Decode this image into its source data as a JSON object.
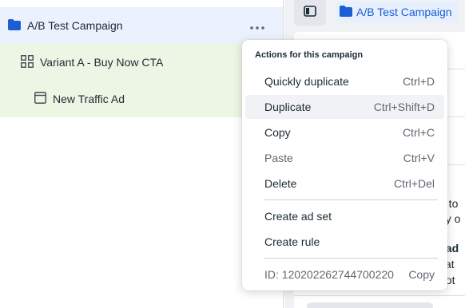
{
  "tree": {
    "campaign": {
      "label": "A/B Test Campaign",
      "icon": "folder-icon"
    },
    "adset": {
      "label": "Variant A - Buy Now CTA",
      "icon": "grid-icon"
    },
    "ad": {
      "label": "New Traffic Ad",
      "icon": "ad-frame-icon"
    },
    "more_icon": "more-horizontal-icon"
  },
  "right_panel": {
    "toggle_icon": "sidebar-toggle-icon",
    "breadcrumb": {
      "label": "A/B Test Campaign",
      "icon": "folder-icon"
    },
    "peek_text": [
      "s",
      "d to",
      "by o",
      "l ad",
      "cat",
      "pot"
    ]
  },
  "menu": {
    "header": "Actions for this campaign",
    "items": [
      {
        "label": "Quickly duplicate",
        "shortcut": "Ctrl+D",
        "state": "normal"
      },
      {
        "label": "Duplicate",
        "shortcut": "Ctrl+Shift+D",
        "state": "hover"
      },
      {
        "label": "Copy",
        "shortcut": "Ctrl+C",
        "state": "normal"
      },
      {
        "label": "Paste",
        "shortcut": "Ctrl+V",
        "state": "disabled"
      },
      {
        "label": "Delete",
        "shortcut": "Ctrl+Del",
        "state": "normal"
      }
    ],
    "create_items": [
      {
        "label": "Create ad set"
      },
      {
        "label": "Create rule"
      }
    ],
    "footer": {
      "id_text": "ID: 120202262744700220",
      "copy_label": "Copy"
    }
  },
  "colors": {
    "accent": "#1a5dd6",
    "campaign_row_bg": "#ebf2fd",
    "adset_row_bg": "#edf5e5",
    "hover_bg": "#f0f2f5"
  }
}
